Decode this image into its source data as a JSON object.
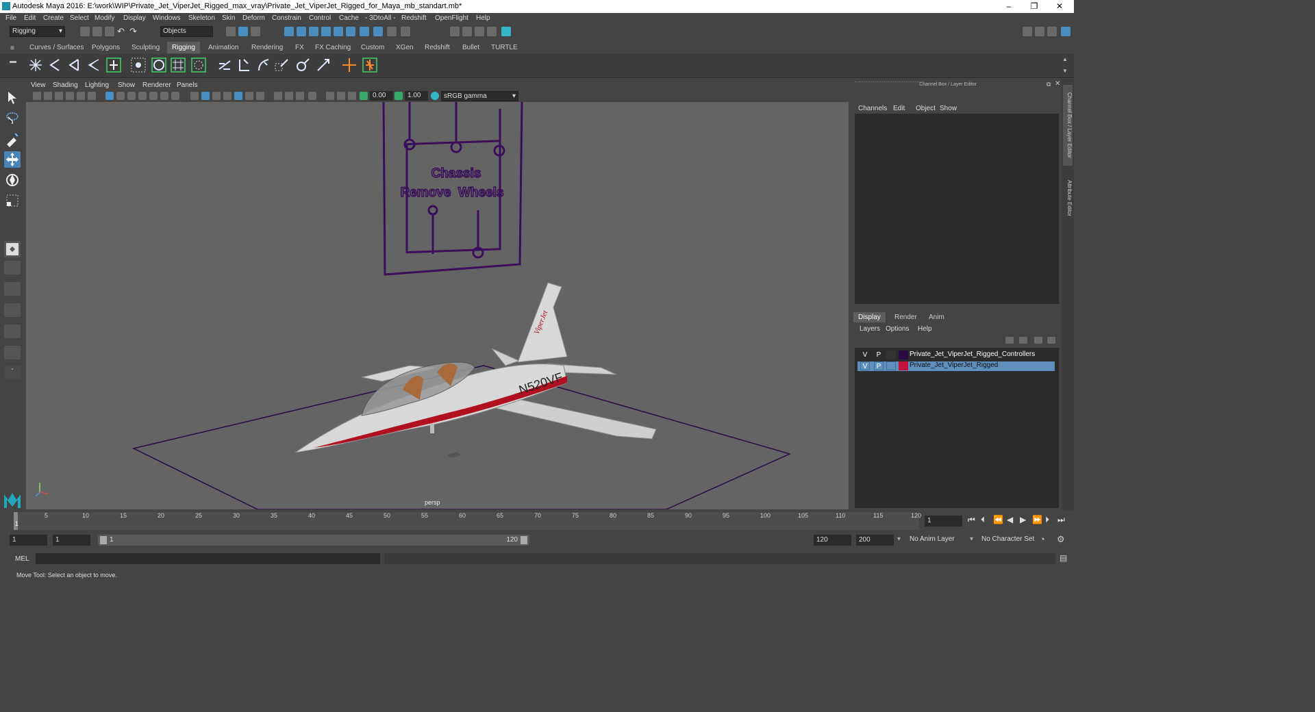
{
  "title": "Autodesk Maya 2016: E:\\work\\WIP\\Private_Jet_ViperJet_Rigged_max_vray\\Private_Jet_ViperJet_Rigged_for_Maya_mb_standart.mb*",
  "window_controls": [
    "–",
    "❐",
    "✕"
  ],
  "menu": [
    "File",
    "Edit",
    "Create",
    "Select",
    "Modify",
    "Display",
    "Windows",
    "Skeleton",
    "Skin",
    "Deform",
    "Constrain",
    "Control",
    "Cache",
    "- 3DtoAll -",
    "Redshift",
    "OpenFlight",
    "Help"
  ],
  "toolbar": {
    "mode": "Rigging",
    "selection_mask": "Objects"
  },
  "shelf_tabs": [
    "Curves / Surfaces",
    "Polygons",
    "Sculpting",
    "Rigging",
    "Animation",
    "Rendering",
    "FX",
    "FX Caching",
    "Custom",
    "XGen",
    "Redshift",
    "Bullet",
    "TURTLE"
  ],
  "shelf_active": "Rigging",
  "viewport": {
    "menu": [
      "View",
      "Shading",
      "Lighting",
      "Show",
      "Renderer",
      "Panels"
    ],
    "exposure": "0.00",
    "gamma": "1.00",
    "color_space": "sRGB gamma",
    "camera_label": "persp",
    "controller_text_1": "Chassis",
    "controller_text_2": "Remove  Wheels",
    "tail_number": "N520VF",
    "fin_text": "ViperJet"
  },
  "right_panel": {
    "title": "Channel Box / Layer Editor",
    "menu": [
      "Channels",
      "Edit",
      "Object",
      "Show"
    ],
    "layer_tabs": [
      "Display",
      "Render",
      "Anim"
    ],
    "layer_active": "Display",
    "layer_menu": [
      "Layers",
      "Options",
      "Help"
    ],
    "layers": [
      {
        "v": "V",
        "p": "P",
        "color": "#2a0a44",
        "name": "Private_Jet_ViperJet_Rigged_Controllers",
        "selected": false
      },
      {
        "v": "V",
        "p": "P",
        "color": "#c0143c",
        "name": "Private_Jet_ViperJet_Rigged",
        "selected": true
      }
    ]
  },
  "side_tabs": [
    "Channel Box / Layer Editor",
    "Attribute Editor"
  ],
  "timeline": {
    "ticks": [
      "5",
      "10",
      "15",
      "20",
      "25",
      "30",
      "35",
      "40",
      "45",
      "50",
      "55",
      "60",
      "65",
      "70",
      "75",
      "80",
      "85",
      "90",
      "95",
      "100",
      "105",
      "110",
      "115",
      "120"
    ],
    "current_marker": "1",
    "current_frame": "1"
  },
  "range": {
    "start": "1",
    "playback_start": "1",
    "slider_start": "1",
    "slider_end": "120",
    "playback_end": "120",
    "end": "200",
    "anim_layer": "No Anim Layer",
    "character_set": "No Character Set"
  },
  "command_line": {
    "label": "MEL"
  },
  "help_line": "Move Tool: Select an object to move.",
  "colors": {
    "accent": "#4b84b7",
    "controller_purple": "#3a0e5a",
    "jet_red": "#b01020"
  }
}
